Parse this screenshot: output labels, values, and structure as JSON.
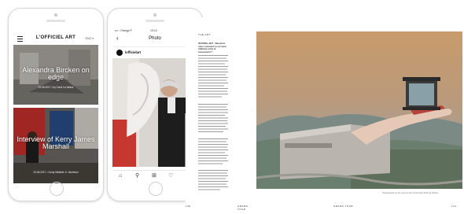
{
  "phone1": {
    "status": {
      "carrier": "",
      "time": "",
      "battery": ""
    },
    "logo": "L'OFFICIEL ART",
    "lang": "ENG ▾",
    "articles": [
      {
        "title": "Alexandra Bircken on edge",
        "meta": "23.06.2017 • by Carol La Valeur"
      },
      {
        "title": "Interview of Kerry James Marshall",
        "meta": "22.06.2017 • Cindy Mirabile Jr. Vachelon"
      }
    ]
  },
  "phone2": {
    "status": {
      "carrier": "•••◦◦ Orange F",
      "time": "19:13",
      "battery": "96 %"
    },
    "title": "Photo",
    "handle": "lofficielart",
    "tabs": [
      "home-icon",
      "search-icon",
      "add-icon",
      "heart-icon",
      "profile-icon"
    ]
  },
  "magazine": {
    "left_header": "THE ART",
    "left_folio": "140",
    "center_folio_left": "GRAND TOUR",
    "center_folio_right": "GRAND TOUR",
    "right_folio": "141",
    "body_heading": "OFFICIEL ART : Racontez-nous comment ce est venu l'alliance entre le mouvement ?",
    "q1": "Sentiment de d'être comment ?",
    "q2": "Comment aété où voyage est ?",
    "q3": "Comment recommande nous collaboré avec la méthode ?",
    "caption": "Photographie en lien avec le site Lichtenstein 2016 de l'artiste"
  },
  "colors": {
    "phone_border": "#d7d7d7",
    "sky_top": "#c89b6b",
    "sky_bottom": "#8fa3b0",
    "building": "#b9b4ad",
    "hand": "#e5c9b6"
  }
}
